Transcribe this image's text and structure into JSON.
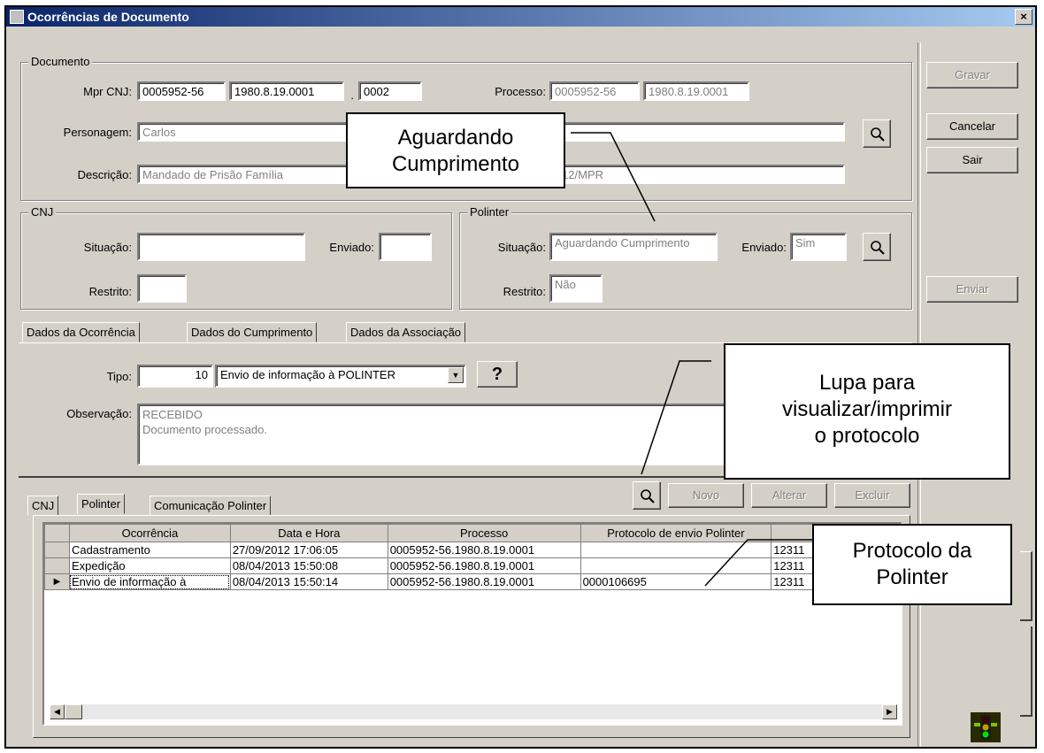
{
  "window": {
    "title": "Ocorrências de Documento",
    "close_label": "×"
  },
  "documento": {
    "legend": "Documento",
    "mpr_label": "Mpr CNJ:",
    "mpr_1": "0005952-56",
    "mpr_2": "1980.8.19.0001",
    "mpr_sep": ".",
    "mpr_3": "0002",
    "processo_label": "Processo:",
    "processo_1": "0005952-56",
    "processo_2": "1980.8.19.0001",
    "personagem_label": "Personagem:",
    "personagem_value": "Carlos",
    "descricao_label": "Descrição:",
    "descricao_value": "Mandado de Prisão Família",
    "descricao_value_2": "/2012/MPR"
  },
  "cnj": {
    "legend": "CNJ",
    "situacao_label": "Situação:",
    "situacao_value": "",
    "enviado_label": "Enviado:",
    "enviado_value": "",
    "restrito_label": "Restrito:",
    "restrito_value": ""
  },
  "polinter": {
    "legend": "Polinter",
    "situacao_label": "Situação:",
    "situacao_value": "Aguardando Cumprimento",
    "enviado_label": "Enviado:",
    "enviado_value": "Sim",
    "restrito_label": "Restrito:",
    "restrito_value": "Não"
  },
  "side_buttons": {
    "gravar": "Gravar",
    "cancelar": "Cancelar",
    "sair": "Sair",
    "enviar": "Enviar"
  },
  "tabs_top": [
    "Dados da Ocorrência",
    "Dados do Cumprimento",
    "Dados da Associação"
  ],
  "ocorrencia": {
    "tipo_label": "Tipo:",
    "tipo_code": "10",
    "tipo_value": "Envio de informação à POLINTER",
    "help_label": "?",
    "observacao_label": "Observação:",
    "observacao_line1": "RECEBIDO",
    "observacao_line2": "Documento processado."
  },
  "tabs_bottom": [
    "CNJ",
    "Polinter",
    "Comunicação Polinter"
  ],
  "grid_buttons": {
    "novo": "Novo",
    "alterar": "Alterar",
    "excluir": "Excluir"
  },
  "grid": {
    "columns": [
      "Ocorrência",
      "Data e Hora",
      "Processo",
      "Protocolo de envio Polinter",
      ""
    ],
    "rows": [
      {
        "ocorrencia": "Cadastramento",
        "data": "27/09/2012 17:06:05",
        "processo": "0005952-56.1980.8.19.0001",
        "protocolo": "",
        "extra": "12311"
      },
      {
        "ocorrencia": "Expedição",
        "data": "08/04/2013 15:50:08",
        "processo": "0005952-56.1980.8.19.0001",
        "protocolo": "",
        "extra": "12311"
      },
      {
        "ocorrencia": "Envio de informação à",
        "data": "08/04/2013 15:50:14",
        "processo": "0005952-56.1980.8.19.0001",
        "protocolo": "0000106695",
        "extra": "12311"
      }
    ]
  },
  "callouts": {
    "aguardando_1": "Aguardando",
    "aguardando_2": "Cumprimento",
    "lupa_1": "Lupa para",
    "lupa_2": "visualizar/imprimir",
    "lupa_3": "o protocolo",
    "protocolo_1": "Protocolo da",
    "protocolo_2": "Polinter"
  }
}
